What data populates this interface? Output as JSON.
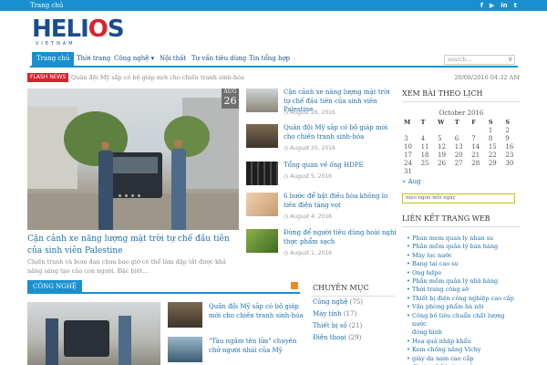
{
  "topbar": {
    "home_label": "Trang chủ",
    "social": [
      {
        "icon": "facebook-icon",
        "glyph": "f"
      },
      {
        "icon": "youtube-icon",
        "glyph": "▶"
      },
      {
        "icon": "linkedin-icon",
        "glyph": "in"
      },
      {
        "icon": "twitter-icon",
        "glyph": "t"
      }
    ]
  },
  "logo": {
    "text_main_a": "HELI",
    "text_main_o": "O",
    "text_main_b": "S",
    "text_sub": "VIETNAM"
  },
  "nav": {
    "items": [
      {
        "label": "Trang chủ",
        "active": true
      },
      {
        "label": "Thời trang",
        "active": false
      },
      {
        "label": "Công nghệ ▾",
        "active": false
      },
      {
        "label": "Nội thất",
        "active": false
      },
      {
        "label": "Tư vấn tiêu dùng",
        "active": false
      },
      {
        "label": "Tin tổng hợp",
        "active": false
      }
    ],
    "search_placeholder": "search..."
  },
  "flash": {
    "tag": "FLASH NEWS",
    "ticker": "Quân đội Mỹ sắp có bộ giáp mới cho chiến tranh sinh-hóa",
    "datetime": "20/08/2016 04:32 AM"
  },
  "hero": {
    "month": "AUG",
    "day": "26",
    "title": "Cận cảnh xe năng lượng mặt trời tự chế đầu tiên của sinh viên Palestine",
    "description": "Chiến tranh và bom đạn chưa bao giờ có thể làm dập tắt được khả năng sáng tạo của con người. Đặc biệt..."
  },
  "side_posts": [
    {
      "title": "Cận cảnh xe năng lượng mặt trời tự chế đầu tiên của sinh viên Palestine",
      "date": "August 26, 2016"
    },
    {
      "title": "Quân đội Mỹ sắp có bộ giáp mới cho chiến tranh sinh-hóa",
      "date": "August 20, 2016"
    },
    {
      "title": "Tổng quan về ống HDPE",
      "date": "August 5, 2016"
    },
    {
      "title": "6 bước để bật điều hòa không lo tiền điện tăng vọt",
      "date": "August 4, 2016"
    },
    {
      "title": "Đừng để người tiêu dùng hoài nghi thực phẩm sạch",
      "date": "August 1, 2016"
    }
  ],
  "section": {
    "label": "CÔNG NGHỆ",
    "items": [
      {
        "title": "Quân đội Mỹ sắp có bộ giáp mới cho chiến tranh sinh-hóa"
      },
      {
        "title": "\"Tàu ngầm tên lửa\" chuyên chở người nhái của Mỹ"
      }
    ]
  },
  "categories": {
    "heading": "CHUYÊN MỤC",
    "items": [
      {
        "name": "Công nghệ",
        "count": "(75)"
      },
      {
        "name": "Máy tính",
        "count": "(17)"
      },
      {
        "name": "Thiết bị số",
        "count": "(21)"
      },
      {
        "name": "Điện thoại",
        "count": "(29)"
      }
    ]
  },
  "calendar": {
    "heading": "XEM BÀI THEO LỊCH",
    "caption": "October 2016",
    "weekdays": [
      "M",
      "T",
      "W",
      "T",
      "F",
      "S",
      "S"
    ],
    "weeks": [
      [
        "",
        "",
        "",
        "",
        "",
        "1",
        "2"
      ],
      [
        "3",
        "4",
        "5",
        "6",
        "7",
        "8",
        "9"
      ],
      [
        "10",
        "11",
        "12",
        "13",
        "14",
        "15",
        "16"
      ],
      [
        "17",
        "18",
        "19",
        "20",
        "21",
        "22",
        "23"
      ],
      [
        "24",
        "25",
        "26",
        "27",
        "28",
        "29",
        "30"
      ],
      [
        "31",
        "",
        "",
        "",
        "",
        "",
        ""
      ]
    ],
    "prev_link": "« Aug",
    "mini_input": "mẹo ngon mỗi ngày"
  },
  "links": {
    "heading": "LIÊN KẾT TRANG WEB",
    "items": [
      "Phan mem quan ly nhan su",
      "Phần mềm quản lý bán hàng",
      "Máy lọc nước",
      "Bang tai cao su",
      "Ong hdpe",
      "Phần mềm quản lý nhà hàng",
      "Thời trang công sở",
      "Thiết bị điện công nghiệp cao cấp",
      "Văn phòng phẩm hà nội",
      "Công bố tiêu chuẩn chất lượng nước",
      "đóng bình",
      "Hoa quả nhập khẩu",
      "Kem chống nắng Vichy",
      "giày da nam cao cấp",
      "đào tạo kế toán trưởng"
    ]
  },
  "colors": {
    "primary": "#1a8fd0",
    "link": "#1a6da8",
    "flash": "#d9232e",
    "rss": "#f08a24"
  }
}
